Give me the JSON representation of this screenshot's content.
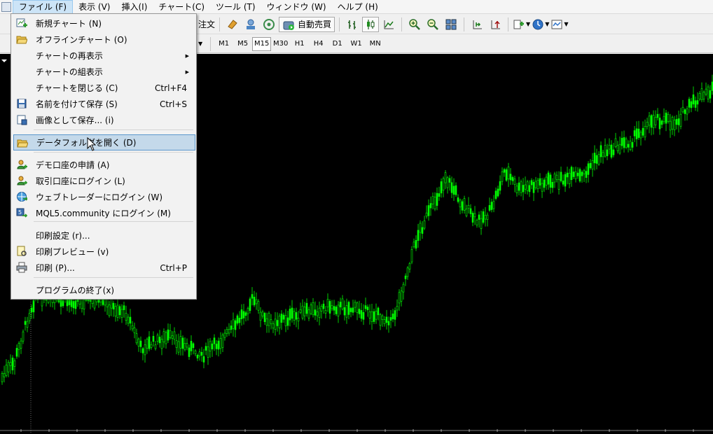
{
  "menubar": {
    "items": [
      {
        "label": "ファイル (F)",
        "active": true
      },
      {
        "label": "表示 (V)"
      },
      {
        "label": "挿入(I)"
      },
      {
        "label": "チャート(C)"
      },
      {
        "label": "ツール (T)"
      },
      {
        "label": "ウィンドウ (W)"
      },
      {
        "label": "ヘルプ (H)"
      }
    ]
  },
  "toolbar": {
    "order_label": "注文",
    "auto_trade_label": "自動売買",
    "timeframes": [
      "M1",
      "M5",
      "M15",
      "M30",
      "H1",
      "H4",
      "D1",
      "W1",
      "MN"
    ],
    "active_timeframe": "M15"
  },
  "file_menu": {
    "items": [
      {
        "label": "新規チャート (N)",
        "shortcut": "",
        "icon": "new-chart-icon"
      },
      {
        "label": "オフラインチャート (O)",
        "shortcut": "",
        "icon": "folder-open-icon"
      },
      {
        "label": "チャートの再表示",
        "shortcut": "",
        "submenu": true
      },
      {
        "label": "チャートの組表示",
        "shortcut": "",
        "submenu": true
      },
      {
        "label": "チャートを閉じる (C)",
        "shortcut": "Ctrl+F4"
      },
      {
        "label": "名前を付けて保存 (S)",
        "shortcut": "Ctrl+S",
        "icon": "save-icon"
      },
      {
        "label": "画像として保存... (i)",
        "shortcut": "",
        "icon": "save-image-icon"
      },
      {
        "label": "データフォルダを開く (D)",
        "shortcut": "",
        "icon": "folder-icon",
        "highlighted": true
      },
      {
        "label": "デモ口座の申請 (A)",
        "shortcut": "",
        "icon": "user-add-icon"
      },
      {
        "label": "取引口座にログイン (L)",
        "shortcut": "",
        "icon": "user-login-icon"
      },
      {
        "label": "ウェブトレーダーにログイン (W)",
        "shortcut": "",
        "icon": "globe-icon"
      },
      {
        "label": "MQL5.community にログイン (M)",
        "shortcut": "",
        "icon": "mql5-icon"
      },
      {
        "label": "印刷設定 (r)...",
        "shortcut": ""
      },
      {
        "label": "印刷プレビュー (v)",
        "shortcut": "",
        "icon": "print-preview-icon"
      },
      {
        "label": "印刷 (P)...",
        "shortcut": "Ctrl+P",
        "icon": "printer-icon"
      },
      {
        "label": "プログラムの終了(x)",
        "shortcut": ""
      }
    ]
  },
  "chart": {
    "background": "#000000",
    "candle_color": "#00ff00",
    "grid_color": "#ffffff"
  }
}
